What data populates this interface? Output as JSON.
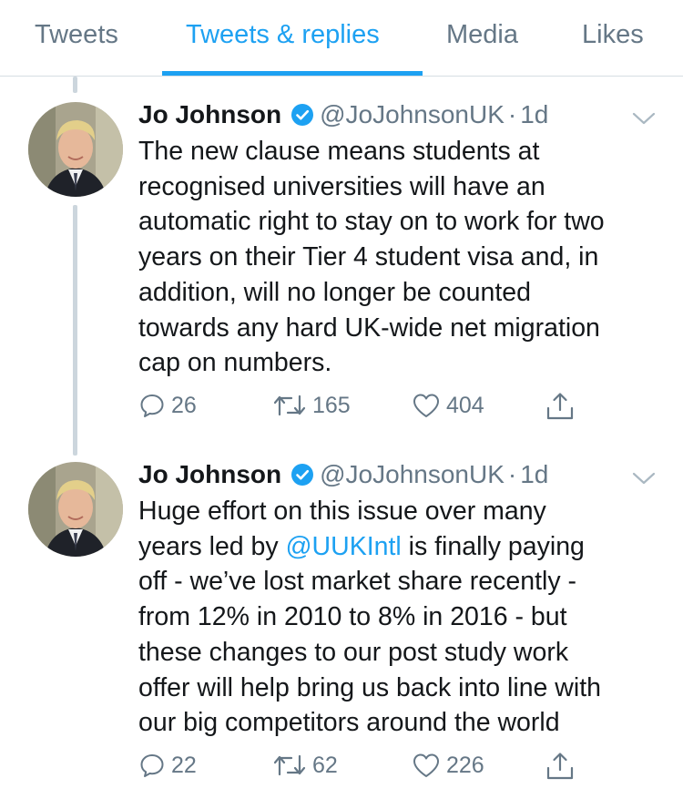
{
  "tabs": [
    {
      "label": "Tweets",
      "active": false
    },
    {
      "label": "Tweets & replies",
      "active": true
    },
    {
      "label": "Media",
      "active": false
    },
    {
      "label": "Likes",
      "active": false
    }
  ],
  "colors": {
    "accent": "#1da1f2",
    "secondary_text": "#657786",
    "border": "#ccd6dd"
  },
  "tweets": [
    {
      "name": "Jo Johnson",
      "handle": "@JoJohnsonUK",
      "dot": "·",
      "time": "1d",
      "text_lines": [
        "The new clause means students at",
        "recognised universities will have an",
        "automatic right to stay on to work for two",
        "years on their Tier 4 student visa and, in",
        "addition, will no longer be counted",
        "towards any hard UK-wide net migration",
        "cap on numbers."
      ],
      "replies": "26",
      "retweets": "165",
      "likes": "404"
    },
    {
      "name": "Jo Johnson",
      "handle": "@JoJohnsonUK",
      "dot": "·",
      "time": "1d",
      "text_line2_prefix": "years led by ",
      "mention": "@UUKIntl",
      "text_line2_suffix": " is finally paying",
      "text_lines": [
        "Huge effort on this issue over many",
        "",
        "off - we’ve lost market share recently -",
        "from 12% in 2010 to 8% in 2016 - but",
        "these changes to our post study work",
        "offer will help bring us back into line with",
        "our big competitors around the world"
      ],
      "replies": "22",
      "retweets": "62",
      "likes": "226"
    }
  ]
}
